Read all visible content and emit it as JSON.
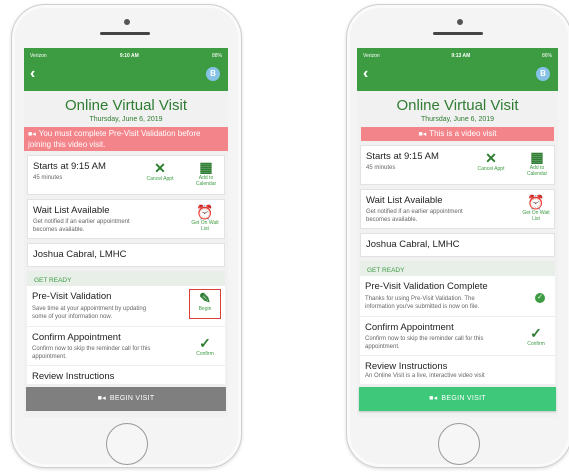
{
  "left": {
    "status": {
      "carrier": "Verizon",
      "time": "9:10 AM",
      "battery": "88%"
    },
    "avatar_initial": "B",
    "title": "Online Virtual Visit",
    "date": "Thursday, June 6, 2019",
    "banner": "You must complete Pre-Visit Validation before joining this video visit.",
    "starts": {
      "title": "Starts at 9:15 AM",
      "duration": "45 minutes",
      "cancel_label": "Cancel Appt",
      "calendar_label": "Add to Calendar"
    },
    "wait": {
      "title": "Wait List Available",
      "desc": "Get notified if an earlier appointment becomes available.",
      "action_label": "Get On Wait List"
    },
    "provider": "Joshua Cabral, LMHC",
    "get_ready": "GET READY",
    "previsit": {
      "title": "Pre-Visit Validation",
      "desc": "Save time at your appointment by updating some of your information now.",
      "action_label": "Begin"
    },
    "confirm": {
      "title": "Confirm Appointment",
      "desc": "Confirm now to skip the reminder call for this appointment.",
      "action_label": "Confirm"
    },
    "review": {
      "title": "Review Instructions"
    },
    "begin_button": "BEGIN VISIT"
  },
  "right": {
    "status": {
      "carrier": "Verizon",
      "time": "9:13 AM",
      "battery": "86%"
    },
    "avatar_initial": "B",
    "title": "Online Virtual Visit",
    "date": "Thursday, June 6, 2019",
    "banner": "This is a video visit",
    "starts": {
      "title": "Starts at 9:15 AM",
      "duration": "45 minutes",
      "cancel_label": "Cancel Appt",
      "calendar_label": "Add to Calendar"
    },
    "wait": {
      "title": "Wait List Available",
      "desc": "Get notified if an earlier appointment becomes available.",
      "action_label": "Get On Wait List"
    },
    "provider": "Joshua Cabral, LMHC",
    "get_ready": "GET READY",
    "previsit": {
      "title": "Pre-Visit Validation Complete",
      "desc": "Thanks for using Pre-Visit Validation. The information you've submitted is now on file."
    },
    "confirm": {
      "title": "Confirm Appointment",
      "desc": "Confirm now to skip the reminder call for this appointment.",
      "action_label": "Confirm"
    },
    "review": {
      "title": "Review Instructions",
      "desc": "An Online Visit is a live, interactive video visit"
    },
    "begin_button": "BEGIN VISIT"
  },
  "colors": {
    "brand_green": "#3d9b42",
    "banner_red": "#f3848a",
    "begin_disabled": "#7f7f7f",
    "begin_enabled": "#3ec97a",
    "highlight": "#d9403b"
  }
}
